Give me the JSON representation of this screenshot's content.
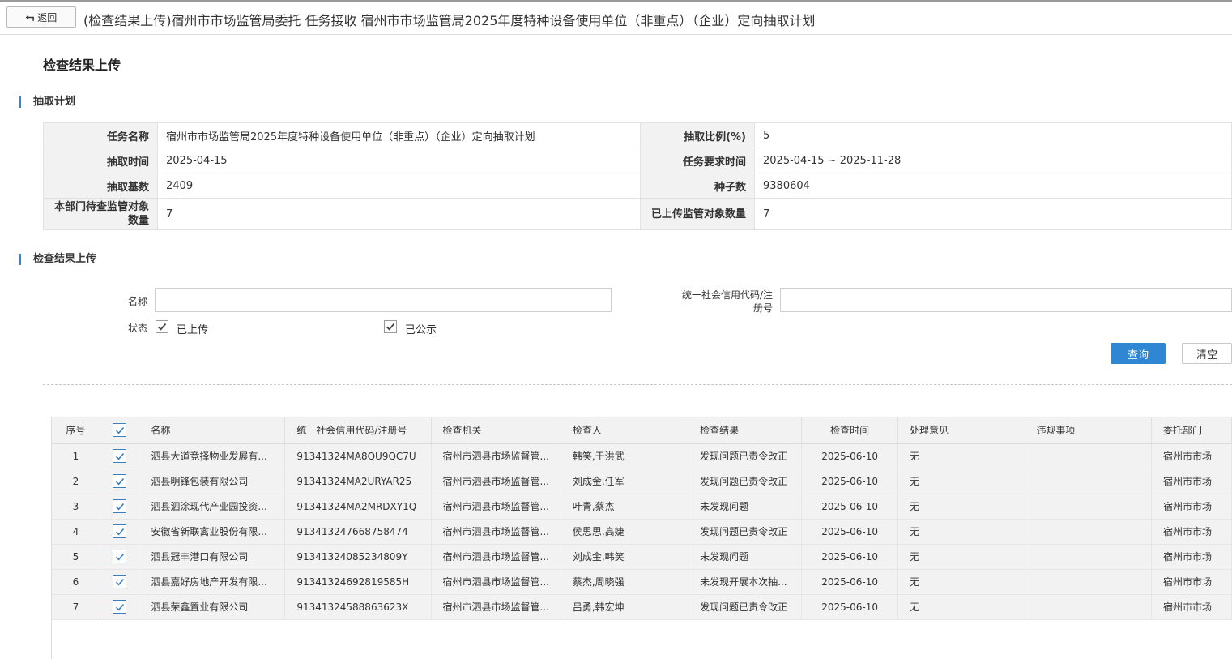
{
  "topbar": {
    "back_label": "返回",
    "title": "(检查结果上传)宿州市市场监管局委托 任务接收 宿州市市场监管局2025年度特种设备使用单位（非重点）（企业）定向抽取计划"
  },
  "page": {
    "heading": "检查结果上传"
  },
  "plan": {
    "section_title": "抽取计划",
    "labels": {
      "task_name": "任务名称",
      "ratio": "抽取比例(%)",
      "draw_time": "抽取时间",
      "required_time": "任务要求时间",
      "base_count": "抽取基数",
      "seed": "种子数",
      "pending_count": "本部门待查监管对象数量",
      "uploaded_count": "已上传监管对象数量"
    },
    "values": {
      "task_name": "宿州市市场监管局2025年度特种设备使用单位（非重点）（企业）定向抽取计划",
      "ratio": "5",
      "draw_time": "2025-04-15",
      "required_time": "2025-04-15 ~ 2025-11-28",
      "base_count": "2409",
      "seed": "9380604",
      "pending_count": "7",
      "uploaded_count": "7"
    }
  },
  "search": {
    "section_title": "检查结果上传",
    "name_label": "名称",
    "name_value": "",
    "credit_label": "统一社会信用代码/注册号",
    "credit_value": "",
    "status_label": "状态",
    "status_options": [
      {
        "label": "已上传",
        "checked": true
      },
      {
        "label": "已公示",
        "checked": true
      }
    ],
    "query_label": "查询",
    "clear_label": "清空"
  },
  "grid": {
    "columns": [
      "序号",
      "",
      "名称",
      "统一社会信用代码/注册号",
      "检查机关",
      "检查人",
      "检查结果",
      "检查时间",
      "处理意见",
      "违规事项",
      "委托部门"
    ],
    "rows": [
      {
        "no": "1",
        "name": "泗县大道竞择物业发展有...",
        "code": "91341324MA8QU9QC7U",
        "org": "宿州市泗县市场监督管...",
        "inspector": "韩笑,于洪武",
        "result": "发现问题已责令改正",
        "time": "2025-06-10",
        "opinion": "无",
        "violation": "",
        "dept": "宿州市市场"
      },
      {
        "no": "2",
        "name": "泗县明锋包装有限公司",
        "code": "91341324MA2URYAR25",
        "org": "宿州市泗县市场监督管...",
        "inspector": "刘成金,任军",
        "result": "发现问题已责令改正",
        "time": "2025-06-10",
        "opinion": "无",
        "violation": "",
        "dept": "宿州市市场"
      },
      {
        "no": "3",
        "name": "泗县泗涂现代产业园投资...",
        "code": "91341324MA2MRDXY1Q",
        "org": "宿州市泗县市场监督管...",
        "inspector": "叶青,蔡杰",
        "result": "未发现问题",
        "time": "2025-06-10",
        "opinion": "无",
        "violation": "",
        "dept": "宿州市市场"
      },
      {
        "no": "4",
        "name": "安徽省新联禽业股份有限...",
        "code": "913413247668758474",
        "org": "宿州市泗县市场监督管...",
        "inspector": "侯思思,高婕",
        "result": "发现问题已责令改正",
        "time": "2025-06-10",
        "opinion": "无",
        "violation": "",
        "dept": "宿州市市场"
      },
      {
        "no": "5",
        "name": "泗县冠丰港口有限公司",
        "code": "91341324085234809Y",
        "org": "宿州市泗县市场监督管...",
        "inspector": "刘成金,韩笑",
        "result": "未发现问题",
        "time": "2025-06-10",
        "opinion": "无",
        "violation": "",
        "dept": "宿州市市场"
      },
      {
        "no": "6",
        "name": "泗县嘉好房地产开发有限...",
        "code": "91341324692819585H",
        "org": "宿州市泗县市场监督管...",
        "inspector": "蔡杰,周晓强",
        "result": "未发现开展本次抽...",
        "time": "2025-06-10",
        "opinion": "无",
        "violation": "",
        "dept": "宿州市市场"
      },
      {
        "no": "7",
        "name": "泗县荣鑫置业有限公司",
        "code": "91341324588863623X",
        "org": "宿州市泗县市场监督管...",
        "inspector": "吕勇,韩宏坤",
        "result": "发现问题已责令改正",
        "time": "2025-06-10",
        "opinion": "无",
        "violation": "",
        "dept": "宿州市市场"
      }
    ]
  },
  "colors": {
    "accent": "#2f86d3",
    "label_bg": "#f2f2f2"
  }
}
